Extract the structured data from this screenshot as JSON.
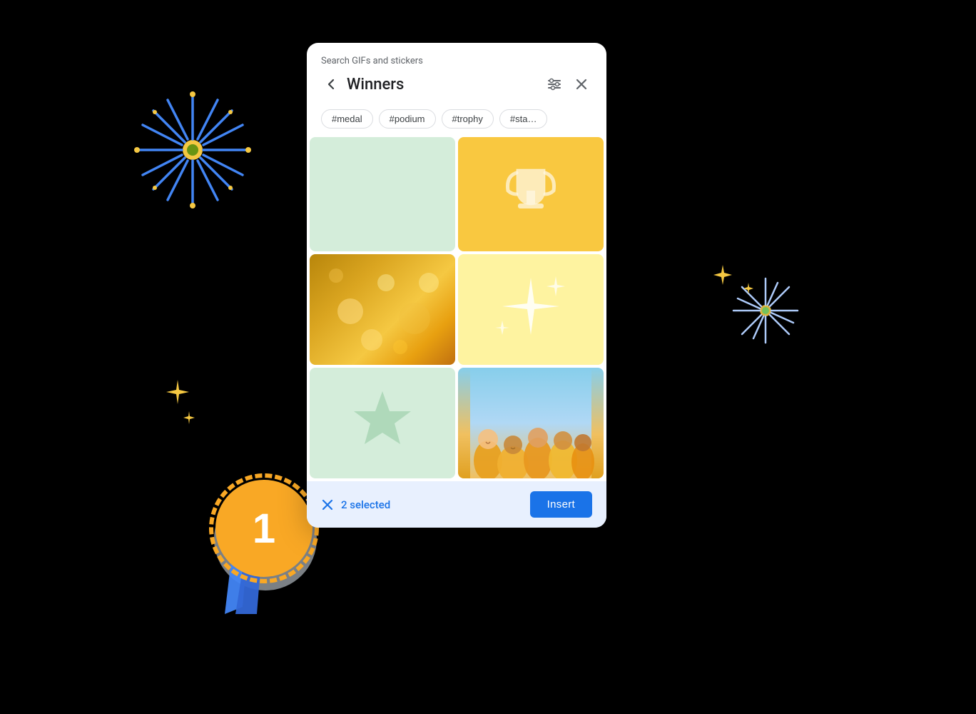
{
  "dialog": {
    "search_label": "Search GIFs and stickers",
    "title": "Winners",
    "back_label": "←",
    "filter_icon": "⊟",
    "close_icon": "✕",
    "tags": [
      "#medal",
      "#podium",
      "#trophy",
      "#sta…"
    ],
    "selected_count": "2 selected",
    "insert_label": "Insert"
  }
}
